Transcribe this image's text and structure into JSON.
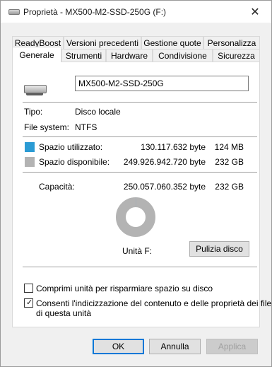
{
  "window": {
    "title": "Proprietà - MX500-M2-SSD-250G (F:)",
    "close_glyph": "✕"
  },
  "tabs": {
    "row1": [
      "ReadyBoost",
      "Versioni precedenti",
      "Gestione quote",
      "Personalizza"
    ],
    "row2": [
      "Generale",
      "Strumenti",
      "Hardware",
      "Condivisione",
      "Sicurezza"
    ],
    "active": "Generale"
  },
  "general": {
    "drive_name": "MX500-M2-SSD-250G",
    "type_label": "Tipo:",
    "type_value": "Disco locale",
    "fs_label": "File system:",
    "fs_value": "NTFS",
    "used_label": "Spazio utilizzato:",
    "used_bytes": "130.117.632 byte",
    "used_short": "124 MB",
    "free_label": "Spazio disponibile:",
    "free_bytes": "249.926.942.720 byte",
    "free_short": "232 GB",
    "capacity_label": "Capacità:",
    "capacity_bytes": "250.057.060.352 byte",
    "capacity_short": "232 GB",
    "drive_label": "Unità F:",
    "cleanup_button": "Pulizia disco",
    "compress_label": "Comprimi unità per risparmiare spazio su disco",
    "compress_checked": false,
    "index_label_line1": "Consenti l'indicizzazione del contenuto e delle proprietà dei file",
    "index_label_line2": "di questa unità",
    "index_checked": true,
    "used_fraction": 0.00052
  },
  "colors": {
    "used": "#2b9bd4",
    "free": "#b3b3b3"
  },
  "footer": {
    "ok": "OK",
    "cancel": "Annulla",
    "apply": "Applica"
  }
}
